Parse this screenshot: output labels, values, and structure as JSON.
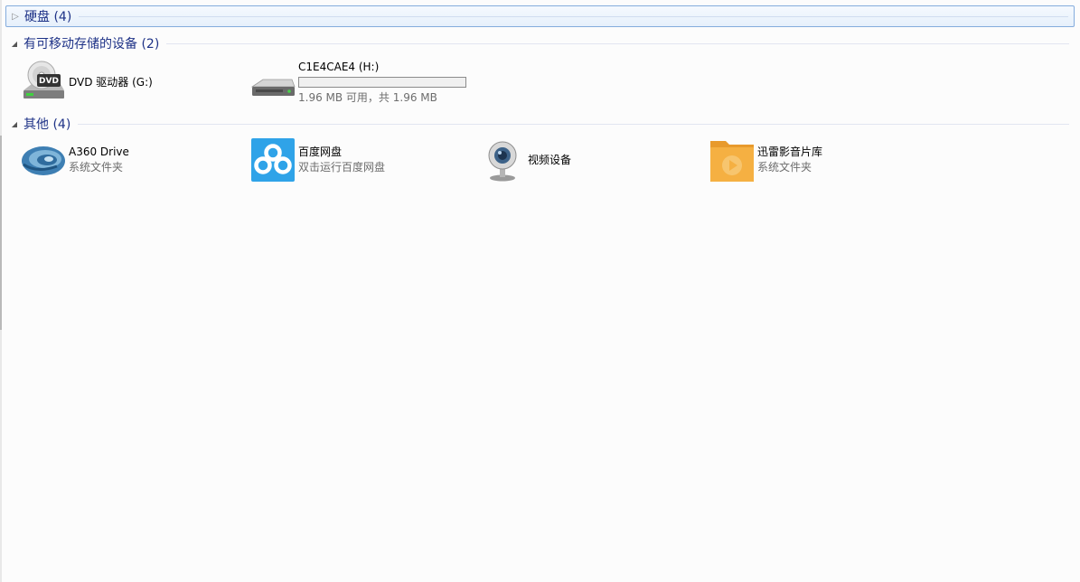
{
  "groups": {
    "hard_disk": {
      "title": "硬盘 (4)",
      "collapsed": true
    },
    "removable": {
      "title": "有可移动存储的设备 (2)",
      "collapsed": false,
      "items": [
        {
          "name": "DVD 驱动器 (G:)",
          "icon": "dvd-drive-icon"
        },
        {
          "name": "C1E4CAE4 (H:)",
          "icon": "usb-drive-icon",
          "usage_fraction": 0,
          "capacity_text": "1.96 MB 可用，共 1.96 MB"
        }
      ]
    },
    "other": {
      "title": "其他 (4)",
      "collapsed": false,
      "items": [
        {
          "name": "A360 Drive",
          "sub": "系统文件夹",
          "icon": "a360-drive-icon"
        },
        {
          "name": "百度网盘",
          "sub": "双击运行百度网盘",
          "icon": "baidu-netdisk-icon"
        },
        {
          "name": "视频设备",
          "icon": "webcam-icon"
        },
        {
          "name": "迅雷影音片库",
          "sub": "系统文件夹",
          "icon": "folder-icon"
        }
      ]
    }
  },
  "colors": {
    "group_title": "#1e3287",
    "bar_fill": "#26a0da",
    "folder": "#f5b042",
    "baidu": "#2fa3e8"
  }
}
